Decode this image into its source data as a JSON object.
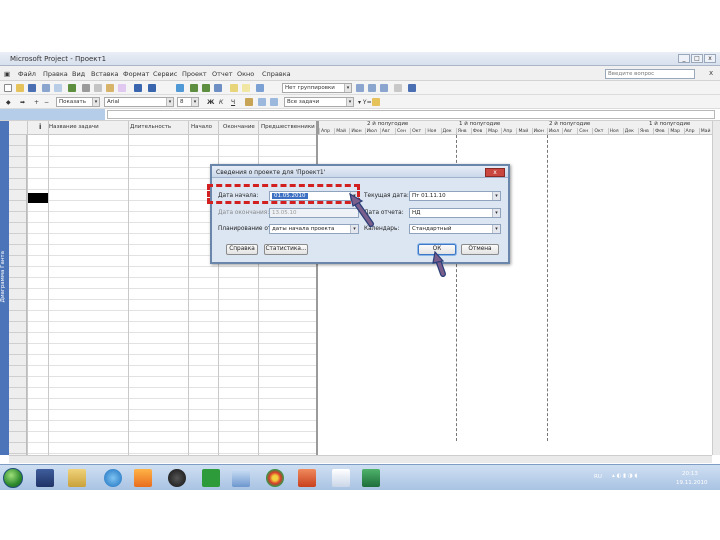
{
  "window": {
    "title": "Microsoft Project - Проект1",
    "controls": [
      "_",
      "□",
      "x"
    ]
  },
  "menu": {
    "items": [
      "Файл",
      "Правка",
      "Вид",
      "Вставка",
      "Формат",
      "Сервис",
      "Проект",
      "Отчет",
      "Окно",
      "Справка"
    ],
    "help_placeholder": "Введите вопрос",
    "close_glyph": "x"
  },
  "toolbar": {
    "group_combo": "Нет группировки",
    "filter_combo": "Все задачи",
    "show_combo": "Показать",
    "font_combo": "Arial",
    "size_combo": "8",
    "tasks_combo": "Все задачи",
    "bold": "Ж",
    "italic": "К",
    "underline": "Ч"
  },
  "table": {
    "info_header": "i",
    "headers": [
      "Название задачи",
      "Длительность",
      "Начало",
      "Окончание",
      "Предшественники"
    ]
  },
  "gantt": {
    "halves": [
      "2 й полугодие",
      "1 й полугодие",
      "2 й полугодие",
      "1 й полугодие"
    ],
    "months": [
      "Апр",
      "Май",
      "Июн",
      "Июл",
      "Авг",
      "Сен",
      "Окт",
      "Ноя",
      "Дек",
      "Янв",
      "Фев",
      "Мар",
      "Апр",
      "Май",
      "Июн",
      "Июл",
      "Авг",
      "Сен",
      "Окт",
      "Ноя",
      "Дек",
      "Янв",
      "Фев",
      "Мар",
      "Апр",
      "Май"
    ]
  },
  "sidebar": {
    "view_label": "Диаграмма Ганта"
  },
  "dialog": {
    "title": "Сведения о проекте для 'Проект1'",
    "close_glyph": "x",
    "start_date_label": "Дата начала:",
    "start_date_value": "01.05.2010",
    "finish_date_label": "Дата окончания:",
    "finish_date_value": "13.05.10",
    "schedule_from_label": "Планирование от:",
    "schedule_from_value": "даты начала проекта",
    "current_date_label": "Текущая дата:",
    "current_date_value": "Пт 01.11.10",
    "status_date_label": "Дата отчета:",
    "status_date_value": "НД",
    "calendar_label": "Календарь:",
    "calendar_value": "Стандартный",
    "help_button": "Справка",
    "statistics_button": "Статистика...",
    "ok_button": "ОК",
    "cancel_button": "Отмена"
  },
  "taskbar": {
    "time": "20:13",
    "date": "19.11.2010",
    "language": "RU"
  },
  "colors": {
    "annotation_red": "#d21f1f",
    "arrow_fill": "#7a5f8c",
    "arrow_outline": "#2a3e78",
    "view_bar": "#4c74b8",
    "selection": "#3d70c3"
  }
}
